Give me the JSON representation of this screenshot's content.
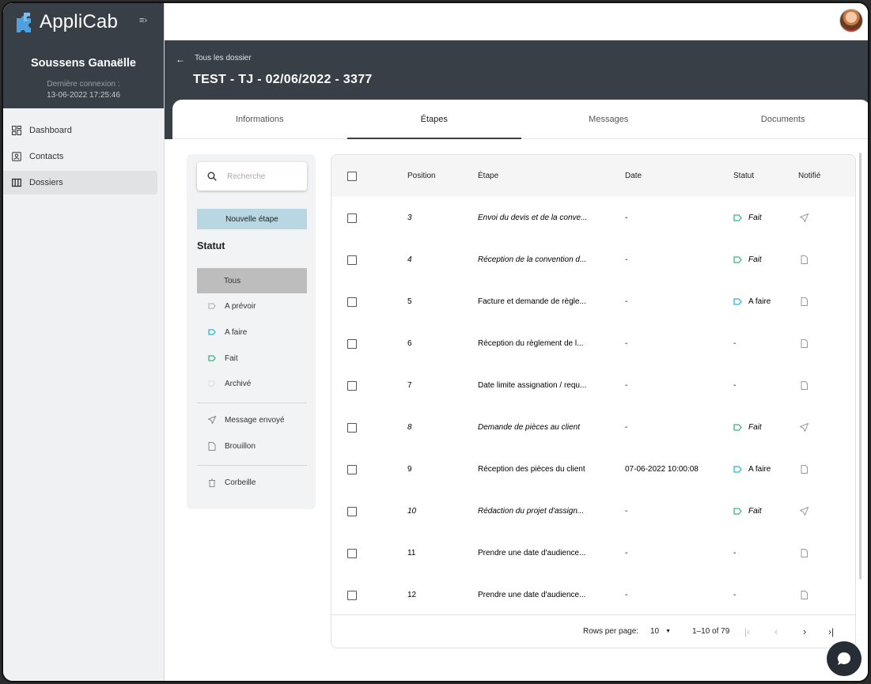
{
  "app": {
    "name": "AppliCab",
    "collapse_icon": "menu-collapse-icon"
  },
  "user": {
    "name": "Soussens Ganaëlle",
    "last_login_label": "Dernière connexion :",
    "last_login": "13-06-2022 17:25:46"
  },
  "nav": [
    {
      "label": "Dashboard",
      "icon": "dashboard-icon"
    },
    {
      "label": "Contacts",
      "icon": "contacts-icon"
    },
    {
      "label": "Dossiers",
      "icon": "dossiers-icon",
      "active": true
    }
  ],
  "header": {
    "back_label": "Tous les dossier",
    "title": "TEST - TJ - 02/06/2022 - 3377"
  },
  "tabs": [
    "Informations",
    "Étapes",
    "Messages",
    "Documents"
  ],
  "filters": {
    "search_placeholder": "Recherche",
    "new_button": "Nouvelle étape",
    "status_heading": "Statut",
    "status_items": [
      "Tous",
      "A prévoir",
      "A faire",
      "Fait",
      "Archivé"
    ],
    "message_items": [
      "Message envoyé",
      "Brouillon"
    ],
    "trash": "Corbeille"
  },
  "table": {
    "headers": {
      "position": "Position",
      "step": "Étape",
      "date": "Date",
      "status": "Statut",
      "notified": "Notifié"
    },
    "rows": [
      {
        "position": "3",
        "step": "Envoi du devis et de la conve...",
        "date": "-",
        "status": "Fait",
        "notified": "sent",
        "italic": true
      },
      {
        "position": "4",
        "step": "Réception de la convention d...",
        "date": "-",
        "status": "Fait",
        "notified": "draft",
        "italic": true
      },
      {
        "position": "5",
        "step": "Facture et demande de règle...",
        "date": "-",
        "status": "A faire",
        "notified": "draft",
        "italic": false
      },
      {
        "position": "6",
        "step": "Réception du règlement de l...",
        "date": "-",
        "status": "-",
        "notified": "draft",
        "italic": false
      },
      {
        "position": "7",
        "step": "Date limite assignation / requ...",
        "date": "-",
        "status": "-",
        "notified": "draft",
        "italic": false
      },
      {
        "position": "8",
        "step": "Demande de pièces au client",
        "date": "-",
        "status": "Fait",
        "notified": "sent",
        "italic": true
      },
      {
        "position": "9",
        "step": "Réception des pièces du client",
        "date": "07-06-2022 10:00:08",
        "status": "A faire",
        "notified": "draft",
        "italic": false
      },
      {
        "position": "10",
        "step": "Rédaction du projet d'assign...",
        "date": "-",
        "status": "Fait",
        "notified": "sent",
        "italic": true
      },
      {
        "position": "11",
        "step": "Prendre une date d'audience...",
        "date": "-",
        "status": "-",
        "notified": "draft",
        "italic": false
      },
      {
        "position": "12",
        "step": "Prendre une date d'audience...",
        "date": "-",
        "status": "-",
        "notified": "draft",
        "italic": false
      }
    ]
  },
  "pagination": {
    "rows_label": "Rows per page:",
    "rows_value": "10",
    "range": "1–10 of 79"
  },
  "colors": {
    "dark": "#383f47",
    "accent_blue": "#b8d7e3",
    "done_green": "#3fb37f",
    "todo_cyan": "#2eb5d9"
  }
}
